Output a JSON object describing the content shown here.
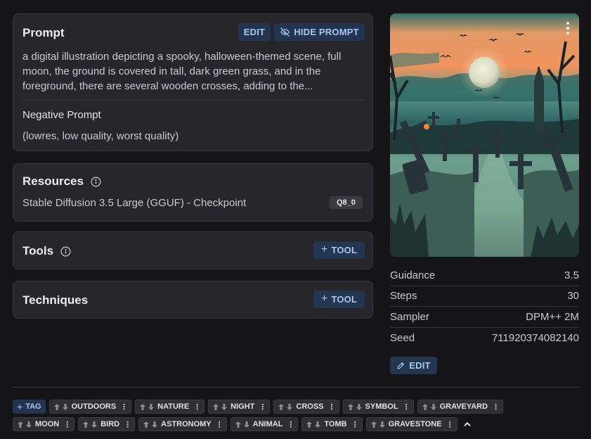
{
  "prompt_card": {
    "title": "Prompt",
    "edit_label": "EDIT",
    "hide_label": "HIDE PROMPT",
    "prompt_text": "a digital illustration depicting a spooky, halloween-themed scene, full moon, the ground is covered in tall, dark green grass, and in the foreground, there are several wooden crosses, adding to the...",
    "negative_title": "Negative Prompt",
    "negative_text": "(lowres, low quality, worst quality)"
  },
  "resources_card": {
    "title": "Resources",
    "item_name": "Stable Diffusion 3.5 Large (GGUF) - Checkpoint",
    "item_badge": "Q8_0"
  },
  "tools_card": {
    "title": "Tools",
    "add_label": "TOOL"
  },
  "techniques_card": {
    "title": "Techniques",
    "add_label": "TOOL"
  },
  "params": [
    {
      "key": "Guidance",
      "value": "3.5"
    },
    {
      "key": "Steps",
      "value": "30"
    },
    {
      "key": "Sampler",
      "value": "DPM++ 2M"
    },
    {
      "key": "Seed",
      "value": "711920374082140"
    }
  ],
  "params_edit_label": "EDIT",
  "tags": {
    "add_label": "TAG",
    "row1": [
      "OUTDOORS",
      "NATURE",
      "NIGHT",
      "CROSS",
      "SYMBOL",
      "GRAVEYARD"
    ],
    "row2": [
      "MOON",
      "BIRD",
      "ASTRONOMY",
      "ANIMAL",
      "TOMB",
      "GRAVESTONE"
    ]
  },
  "colors": {
    "background": "#151518",
    "card": "#26262b",
    "accent_button": "#223652",
    "accent_text": "#a9c7f0"
  }
}
